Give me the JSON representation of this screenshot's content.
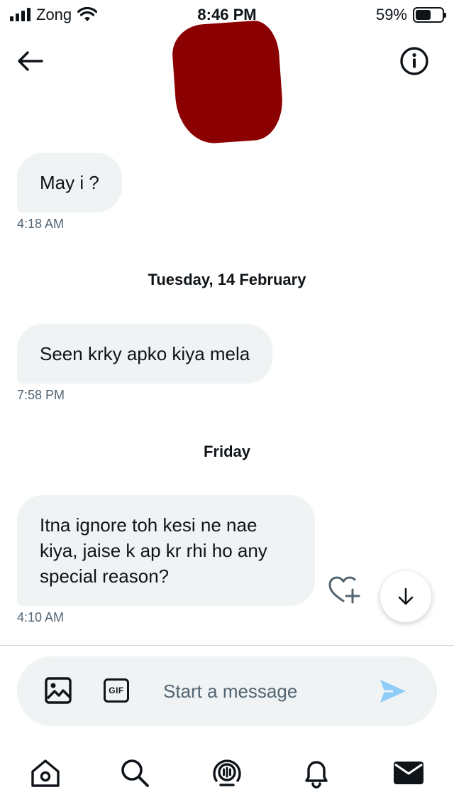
{
  "status_bar": {
    "carrier": "Zong",
    "time": "8:46 PM",
    "battery_percent": "59%",
    "battery_level": 0.59,
    "signal_bars": 4
  },
  "header": {
    "back_icon": "arrow-left-icon",
    "info_icon": "info-circle-icon",
    "avatar_redacted_color": "#8b0000"
  },
  "conversation": {
    "messages": [
      {
        "text": "May i ?",
        "time": "4:18 AM"
      },
      {
        "text": "Seen krky apko kiya mela",
        "time": "7:58 PM"
      },
      {
        "text": "Itna ignore toh kesi ne nae kiya, jaise k ap kr rhi ho any special reason?",
        "time": "4:10 AM"
      }
    ],
    "date_separators": [
      "Tuesday, 14 February",
      "Friday"
    ]
  },
  "composer": {
    "placeholder": "Start a message",
    "gif_label": "GIF",
    "image_icon": "image-icon",
    "send_icon": "send-icon"
  },
  "bottom_nav": {
    "items": [
      "home-icon",
      "search-icon",
      "spaces-icon",
      "notifications-icon",
      "messages-icon"
    ],
    "active": "messages-icon"
  },
  "colors": {
    "bubble_bg": "#eff3f4",
    "text": "#0f1419",
    "secondary_text": "#536471",
    "send_icon": "#8ecdf8",
    "divider": "#cfd9de"
  }
}
